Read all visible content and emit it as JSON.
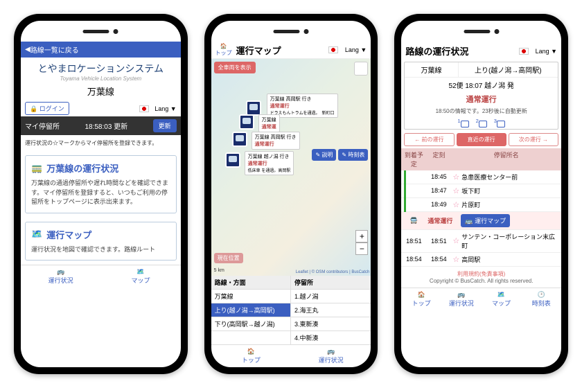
{
  "phone1": {
    "back_label": "路線一覧に戻る",
    "system_title": "とやまロケーションシステム",
    "system_sub": "Toyama Vehicle Location System",
    "route_name": "万葉線",
    "login_label": "ログイン",
    "lang_label": "Lang ▼",
    "mystop_label": "マイ停留所",
    "update_time": "18:58:03 更新",
    "update_btn": "更新",
    "mystop_note": "運行状況の☆マークからマイ停留所を登録できます。",
    "card1_title": "万葉線の運行状況",
    "card1_body": "万葉線の通過停留所や遅れ時間などを確認できます。マイ停留所を登録すると、いつもご利用の停留所をトップページに表示出来ます。",
    "card2_title": "運行マップ",
    "card2_body": "運行状況を地図で確認できます。路線ルート",
    "tabs": [
      "運行状況",
      "マップ"
    ]
  },
  "phone2": {
    "top_label": "トップ",
    "title": "運行マップ",
    "lang_label": "Lang ▼",
    "all_vehicles": "全車両を表示",
    "popups": [
      {
        "dest": "万葉線 高岡駅 行き",
        "status": "通常運行",
        "extra": "ドラえもんトラムを通過。　新町口"
      },
      {
        "dest": "万葉線",
        "status": "通常運"
      },
      {
        "dest": "万葉線 高岡駅 行き",
        "status": "通常運行"
      },
      {
        "dest": "万葉線 越ノ潟 行き",
        "status": "通常運行",
        "extra": "低床車 を通過。高岡駅"
      }
    ],
    "btn_desc": "説明",
    "btn_tt": "時刻表",
    "loc_btn": "現在位置",
    "scale": "5 km",
    "attr": "Leaflet | © OSM contributors | BusCatch",
    "table_head": [
      "路線・方面",
      "停留所"
    ],
    "rows": [
      {
        "c1": "万葉線",
        "c2": "1.越ノ潟",
        "sel": false
      },
      {
        "c1": "上り(越ノ潟→高岡駅)",
        "c2": "2.海王丸",
        "sel": true
      },
      {
        "c1": "下り(高岡駅→越ノ潟)",
        "c2": "3.東新湊",
        "sel": false
      },
      {
        "c1": "",
        "c2": "4.中新湊",
        "sel": false
      }
    ],
    "tabs": [
      "トップ",
      "運行状況"
    ]
  },
  "phone3": {
    "title": "路線の運行状況",
    "lang_label": "Lang ▼",
    "route": "万葉線",
    "direction": "上り(越ノ潟→高岡駅)",
    "trip": "52便 18:07 越ノ潟 発",
    "status": "通常運行",
    "info": "18:50の情報です。23秒後に自動更新",
    "nums": [
      "1",
      "2",
      "3"
    ],
    "nav": [
      "← 前の運行",
      "直近の運行",
      "次の運行 →"
    ],
    "thead": [
      "到着予定",
      "定刻",
      "停留所名"
    ],
    "stops": [
      {
        "arr": "",
        "sch": "18:45",
        "name": "急患医療センター前"
      },
      {
        "arr": "",
        "sch": "18:47",
        "name": "坂下町"
      },
      {
        "arr": "",
        "sch": "18:49",
        "name": "片原町"
      }
    ],
    "current_status": "通常運行",
    "map_btn": "運行マップ",
    "stops2": [
      {
        "arr": "18:51",
        "sch": "18:51",
        "name": "サンテン・コーポレーション末広町"
      },
      {
        "arr": "18:54",
        "sch": "18:54",
        "name": "高岡駅"
      }
    ],
    "terms": "利用規約(免責事項)",
    "copyright": "Copyright © BusCatch. All rights reserved.",
    "tabs": [
      "トップ",
      "運行状況",
      "マップ",
      "時刻表"
    ]
  }
}
